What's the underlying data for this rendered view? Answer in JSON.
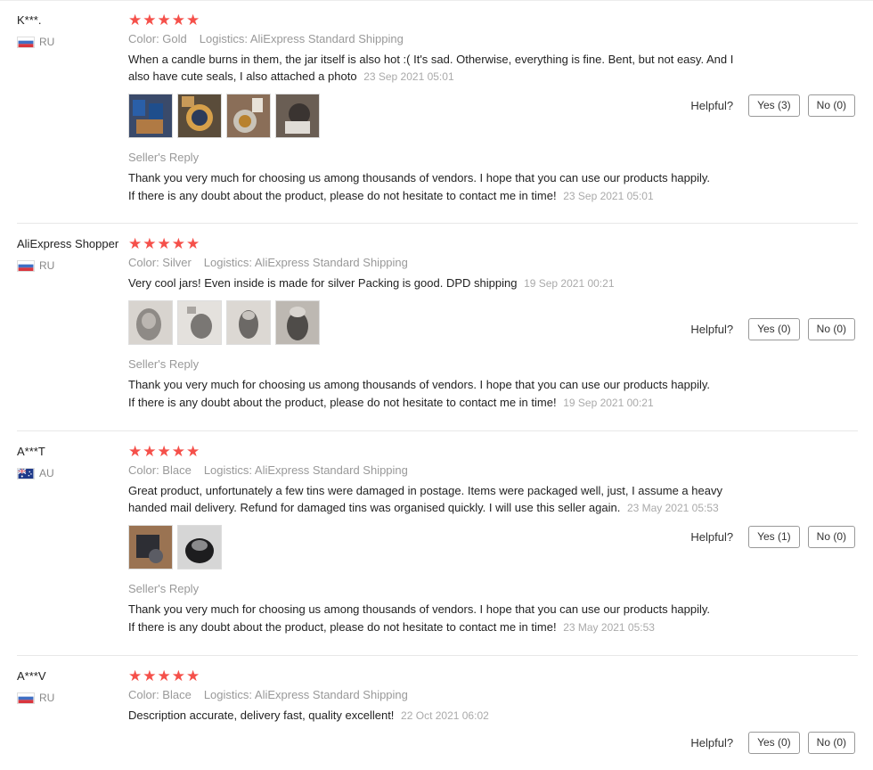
{
  "reviews": [
    {
      "user": "K***.",
      "country": "RU",
      "stars": "★★★★★",
      "color": "Color: Gold",
      "logistics": "Logistics: AliExpress Standard Shipping",
      "text": "When a candle burns in them, the jar itself is also hot :( It's sad. Otherwise, everything is fine. Bent, but not easy. And I also have cute seals, I also attached a photo",
      "date": "23 Sep 2021 05:01",
      "helpful_label": "Helpful?",
      "yes": "Yes (3)",
      "no": "No (0)",
      "seller_reply_label": "Seller's Reply",
      "reply_line1": "Thank you very much for choosing us among thousands of vendors. I hope that you can use our products happily.",
      "reply_line2": "If there is any doubt about the product, please do not hesitate to contact me in time!",
      "reply_date": "23 Sep 2021 05:01"
    },
    {
      "user": "AliExpress Shopper",
      "country": "RU",
      "stars": "★★★★★",
      "color": "Color: Silver",
      "logistics": "Logistics: AliExpress Standard Shipping",
      "text": "Very cool jars! Even inside is made for silver Packing is good. DPD shipping",
      "date": "19 Sep 2021 00:21",
      "helpful_label": "Helpful?",
      "yes": "Yes (0)",
      "no": "No (0)",
      "seller_reply_label": "Seller's Reply",
      "reply_line1": "Thank you very much for choosing us among thousands of vendors. I hope that you can use our products happily.",
      "reply_line2": "If there is any doubt about the product, please do not hesitate to contact me in time!",
      "reply_date": "19 Sep 2021 00:21"
    },
    {
      "user": "A***T",
      "country": "AU",
      "stars": "★★★★★",
      "color": "Color: Blace",
      "logistics": "Logistics: AliExpress Standard Shipping",
      "text": "Great product, unfortunately a few tins were damaged in postage. Items were packaged well, just, I assume a heavy handed mail delivery. Refund for damaged tins was organised quickly. I will use this seller again.",
      "date": "23 May 2021 05:53",
      "helpful_label": "Helpful?",
      "yes": "Yes (1)",
      "no": "No (0)",
      "seller_reply_label": "Seller's Reply",
      "reply_line1": "Thank you very much for choosing us among thousands of vendors. I hope that you can use our products happily.",
      "reply_line2": "If there is any doubt about the product, please do not hesitate to contact me in time!",
      "reply_date": "23 May 2021 05:53"
    },
    {
      "user": "A***V",
      "country": "RU",
      "stars": "★★★★★",
      "color": "Color: Blace",
      "logistics": "Logistics: AliExpress Standard Shipping",
      "text": "Description accurate, delivery fast, quality excellent!",
      "date": "22 Oct 2021 06:02",
      "helpful_label": "Helpful?",
      "yes": "Yes (0)",
      "no": "No (0)"
    }
  ],
  "colors": {
    "star": "#f5504a",
    "meta": "#999999",
    "border": "#e8e8e8"
  }
}
